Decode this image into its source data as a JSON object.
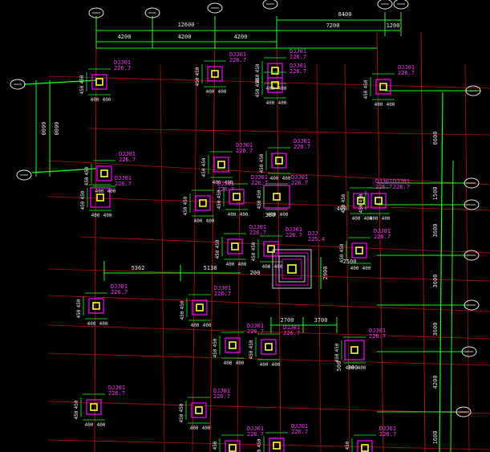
{
  "colors": {
    "background": "#000000",
    "grid_line": "#b01010",
    "dimension": "#19ff19",
    "column_outline": "#ff00ff",
    "column_core": "#ffff33",
    "label_text": "#ff33ff",
    "axis_bubble": "#e8e8e8"
  },
  "dimensions_top": [
    "12600",
    "4200",
    "4200",
    "4200",
    "8400",
    "7200",
    "1200"
  ],
  "dimensions_right": [
    "6600",
    "1500",
    "3600",
    "3600",
    "3600",
    "4200",
    "1600"
  ],
  "dimensions_left": [
    "6600",
    "6600"
  ],
  "dimensions_misc": [
    "5362",
    "5138",
    "2700",
    "3700",
    "2500",
    "2900"
  ],
  "column_labels": {
    "foundation_code": "DJJ01",
    "elevation": "226.7",
    "special_code": "DJJ",
    "special_elevation": "225.4"
  },
  "column_dims": [
    "400",
    "450",
    "380",
    "500",
    "300",
    "200"
  ]
}
